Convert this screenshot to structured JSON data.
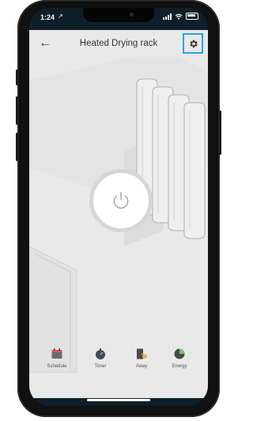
{
  "status_bar": {
    "time": "1:24",
    "location_arrow": "↗"
  },
  "header": {
    "title": "Heated Drying rack",
    "back_icon": "←"
  },
  "nav": [
    {
      "label": "Schedule",
      "icon": "calendar-icon"
    },
    {
      "label": "Timer",
      "icon": "timer-icon"
    },
    {
      "label": "Away",
      "icon": "away-icon"
    },
    {
      "label": "Energy",
      "icon": "energy-icon"
    }
  ],
  "colors": {
    "accent": "#1ea7e8",
    "app_bg": "#e9e9e9",
    "power_ring": "#d6d6d6"
  }
}
